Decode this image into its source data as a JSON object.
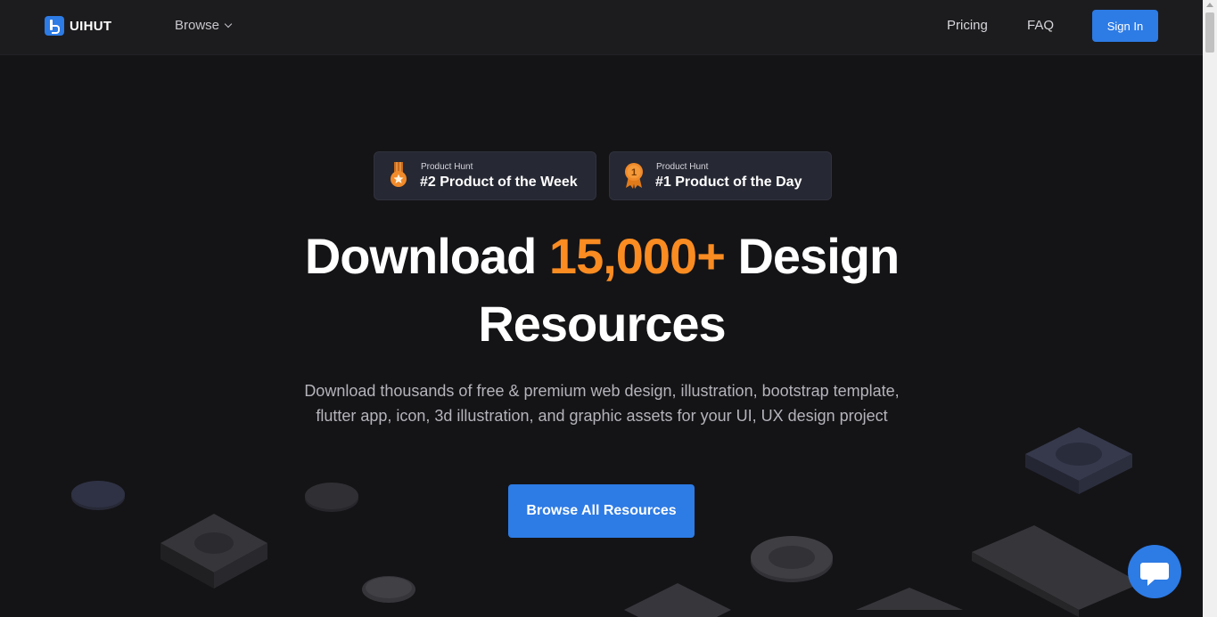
{
  "header": {
    "logo_text": "UIHUT",
    "browse_label": "Browse",
    "pricing_label": "Pricing",
    "faq_label": "FAQ",
    "signin_label": "Sign In"
  },
  "badges": [
    {
      "source": "Product Hunt",
      "title": "#2 Product of the Week",
      "icon": "medal-icon"
    },
    {
      "source": "Product Hunt",
      "title": "#1 Product of the Day",
      "icon": "award-ribbon-icon",
      "rank": "1"
    }
  ],
  "hero": {
    "title_prefix": "Download",
    "title_highlight": "15,000+",
    "title_suffix": "Design",
    "title_line2": "Resources",
    "subtitle": "Download thousands of free & premium web design, illustration, bootstrap template, flutter app, icon, 3d illustration, and graphic assets for your UI, UX design project",
    "cta_label": "Browse All Resources"
  },
  "colors": {
    "accent": "#2d7be5",
    "highlight": "#fa8c22",
    "background": "#141417"
  },
  "chat_widget": {
    "icon": "chat-icon"
  }
}
